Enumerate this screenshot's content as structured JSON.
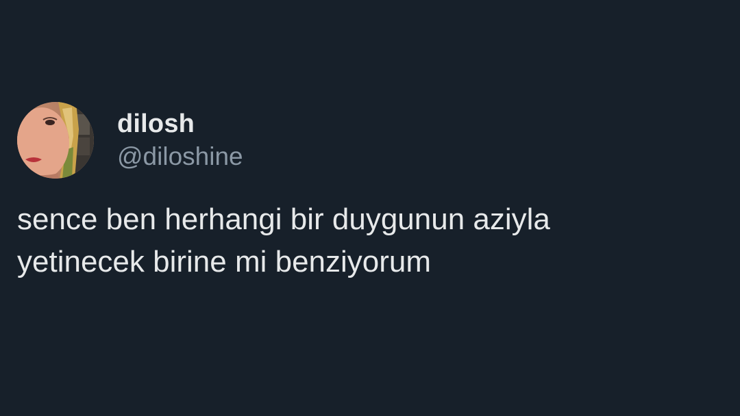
{
  "tweet": {
    "avatar_icon": "user-avatar-photo",
    "display_name": "dilosh",
    "handle": "@diloshine",
    "text": "sence ben herhangi bir duygunun aziyla\nyetinecek birine mi benziyorum"
  },
  "colors": {
    "background": "#17202a",
    "primary_text": "#e7e9ea",
    "secondary_text": "#8b98a5"
  }
}
